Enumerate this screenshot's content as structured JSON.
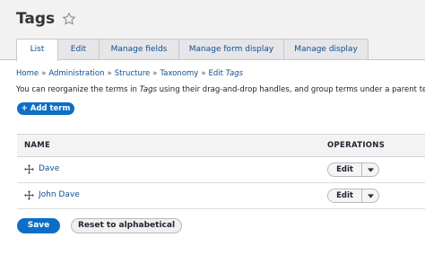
{
  "page": {
    "title": "Tags"
  },
  "tabs": [
    {
      "label": "List",
      "active": true
    },
    {
      "label": "Edit",
      "active": false
    },
    {
      "label": "Manage fields",
      "active": false
    },
    {
      "label": "Manage form display",
      "active": false
    },
    {
      "label": "Manage display",
      "active": false
    }
  ],
  "breadcrumb": {
    "home": "Home",
    "administration": "Administration",
    "structure": "Structure",
    "taxonomy": "Taxonomy",
    "edit_prefix": "Edit",
    "edit_vocab": "Tags",
    "separator": "»"
  },
  "help": {
    "prefix": "You can reorganize the terms in",
    "vocab": "Tags",
    "suffix": "using their drag-and-drop handles, and group terms under a parent term b"
  },
  "actions": {
    "add_term": "+ Add term"
  },
  "table": {
    "headers": {
      "name": "NAME",
      "operations": "OPERATIONS"
    },
    "rows": [
      {
        "name": "Dave",
        "operation": "Edit"
      },
      {
        "name": "John Dave",
        "operation": "Edit"
      }
    ]
  },
  "form": {
    "save": "Save",
    "reset": "Reset to alphabetical"
  },
  "icons": {
    "favorite": "star-icon",
    "drag": "drag-handle-icon",
    "dropdown": "chevron-down-icon"
  },
  "colors": {
    "primary": "#0d6ec7",
    "link": "#0d4f91",
    "header_bg": "#f2f2f3"
  }
}
